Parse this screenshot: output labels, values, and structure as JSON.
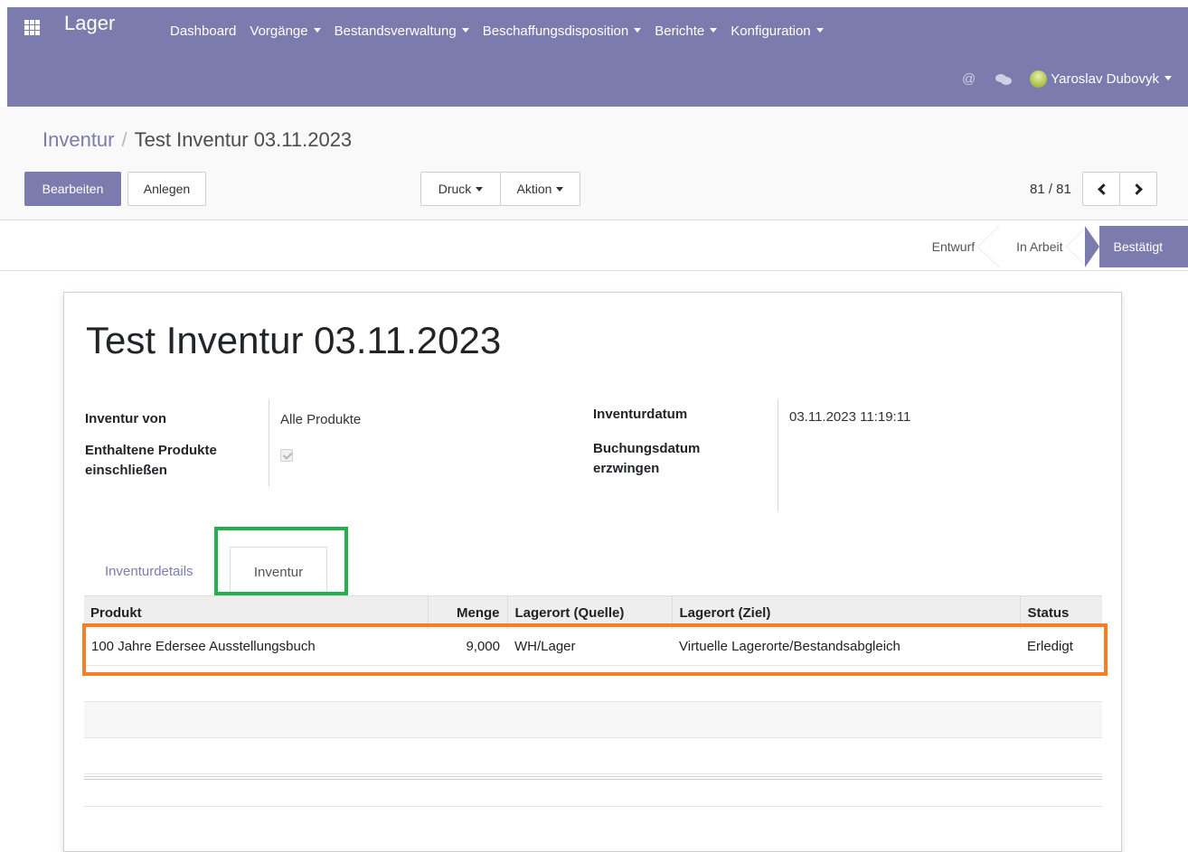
{
  "navbar": {
    "app_title": "Lager",
    "menu": [
      "Dashboard",
      "Vorgänge",
      "Bestandsverwaltung",
      "Beschaffungsdisposition",
      "Berichte",
      "Konfiguration"
    ],
    "at_symbol": "@",
    "user_name": "Yaroslav Dubovyk"
  },
  "breadcrumb": {
    "parent": "Inventur",
    "separator": "/",
    "current": "Test Inventur 03.11.2023"
  },
  "buttons": {
    "edit": "Bearbeiten",
    "create": "Anlegen",
    "print": "Druck",
    "action": "Aktion"
  },
  "pager": {
    "value": "81 / 81"
  },
  "statusbar": {
    "steps": [
      "Entwurf",
      "In Arbeit",
      "Bestätigt"
    ],
    "active": "Bestätigt"
  },
  "form": {
    "title": "Test Inventur 03.11.2023",
    "inventory_of_label": "Inventur von",
    "inventory_of_value": "Alle Produkte",
    "include_products_label": "Enthaltene Produkte einschließen",
    "include_products_checked": true,
    "inventory_date_label": "Inventurdatum",
    "inventory_date_value": "03.11.2023 11:19:11",
    "force_booking_date_label": "Buchungsdatum erzwingen"
  },
  "tabs": [
    "Inventurdetails",
    "Inventur"
  ],
  "table": {
    "columns": [
      "Produkt",
      "Menge",
      "Lagerort (Quelle)",
      "Lagerort (Ziel)",
      "Status"
    ],
    "rows": [
      [
        "100 Jahre Edersee Ausstellungsbuch",
        "9,000",
        "WH/Lager",
        "Virtuelle Lagerorte/Bestandsabgleich",
        "Erledigt"
      ]
    ]
  },
  "colors": {
    "brand": "#7c7bad",
    "highlight_green": "#22b14c",
    "highlight_orange": "#f47f27"
  }
}
